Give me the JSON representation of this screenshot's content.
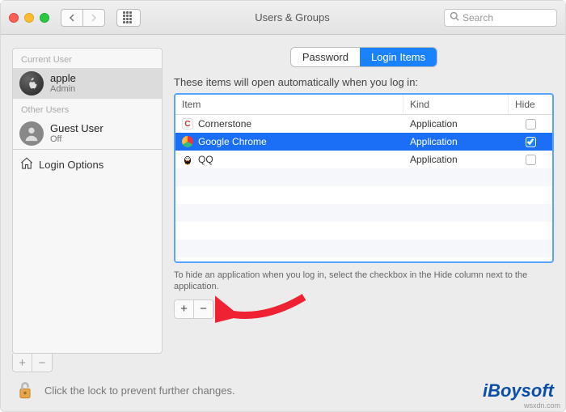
{
  "window": {
    "title": "Users & Groups",
    "search_placeholder": "Search"
  },
  "sidebar": {
    "current_label": "Current User",
    "other_label": "Other Users",
    "users": [
      {
        "name": "apple",
        "role": "Admin",
        "selected": true,
        "avatar": "apple"
      },
      {
        "name": "Guest User",
        "role": "Off",
        "selected": false,
        "avatar": "guest"
      }
    ],
    "login_options_label": "Login Options"
  },
  "tabs": {
    "password": "Password",
    "login_items": "Login Items",
    "active": "login_items"
  },
  "main": {
    "description": "These items will open automatically when you log in:",
    "columns": {
      "item": "Item",
      "kind": "Kind",
      "hide": "Hide"
    },
    "rows": [
      {
        "icon": "cornerstone",
        "name": "Cornerstone",
        "kind": "Application",
        "hide": false,
        "selected": false
      },
      {
        "icon": "chrome",
        "name": "Google Chrome",
        "kind": "Application",
        "hide": true,
        "selected": true
      },
      {
        "icon": "qq",
        "name": "QQ",
        "kind": "Application",
        "hide": false,
        "selected": false
      }
    ],
    "hint": "To hide an application when you log in, select the checkbox in the Hide column next to the application.",
    "add_label": "+",
    "remove_label": "−"
  },
  "footer": {
    "lock_text": "Click the lock to prevent further changes."
  },
  "branding": {
    "text": "iBoysoft",
    "site": "wsxdn.com"
  }
}
